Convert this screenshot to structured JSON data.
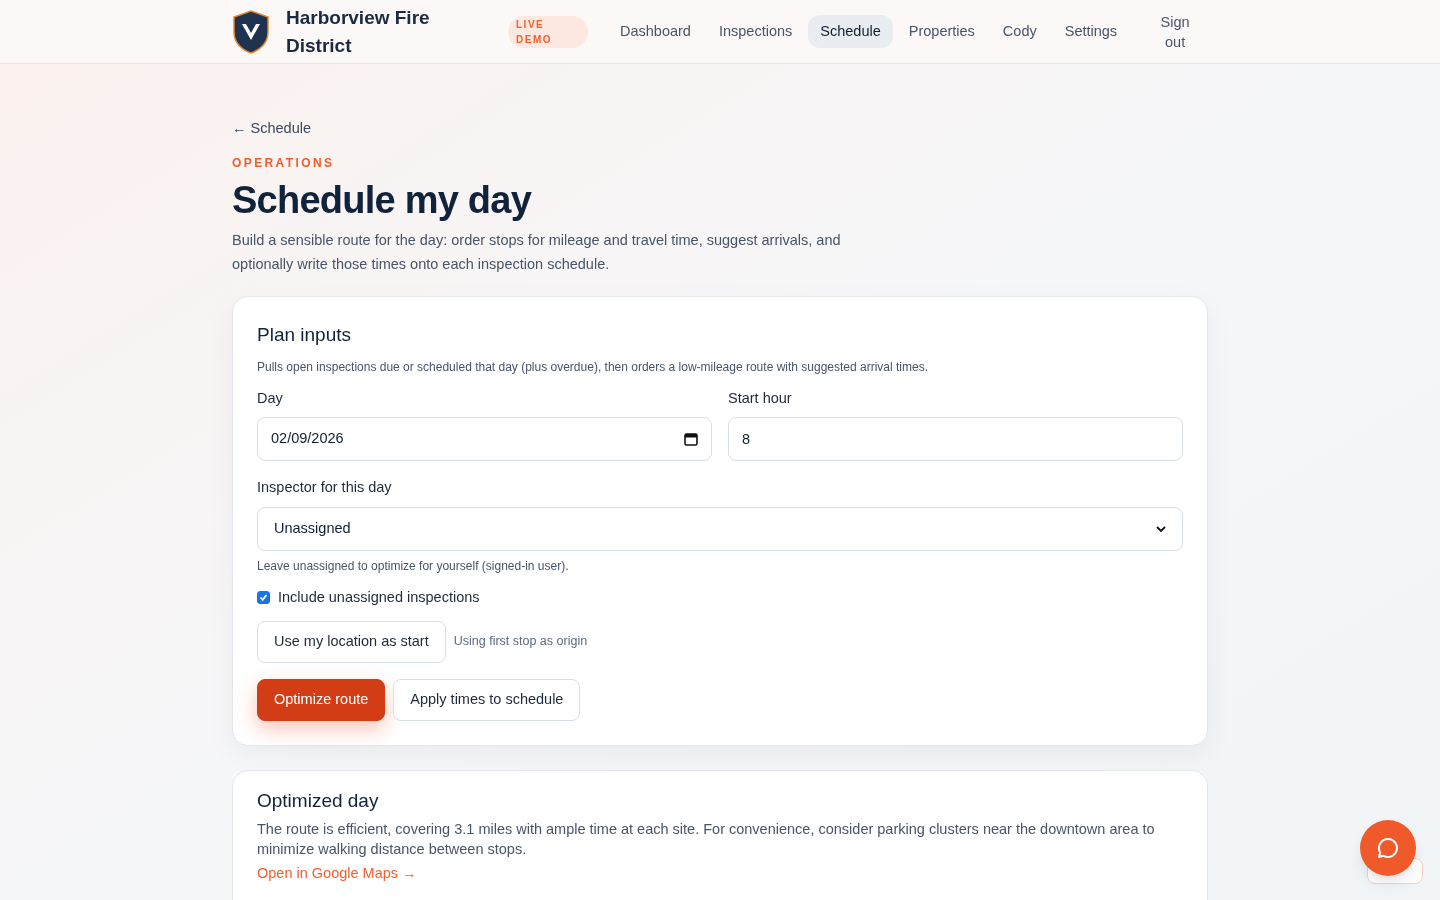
{
  "header": {
    "brand": "Harborview Fire District",
    "badge": "LIVE DEMO",
    "nav": [
      {
        "label": "Dashboard",
        "selected": false
      },
      {
        "label": "Inspections",
        "selected": false
      },
      {
        "label": "Schedule",
        "selected": true
      },
      {
        "label": "Properties",
        "selected": false
      },
      {
        "label": "Cody",
        "selected": false
      },
      {
        "label": "Settings",
        "selected": false
      },
      {
        "label": "Sign out",
        "selected": false
      }
    ]
  },
  "back_link": "← Schedule",
  "eyebrow": "OPERATIONS",
  "title": "Schedule my day",
  "intro": "Build a sensible route for the day: order stops for mileage and travel time, suggest arrivals, and optionally write those times onto each inspection schedule.",
  "plan": {
    "title": "Plan inputs",
    "description": "Pulls open inspections due or scheduled that day (plus overdue), then orders a low-mileage route with suggested arrival times.",
    "day": {
      "label": "Day",
      "value": "02/09/2026"
    },
    "start_hour": {
      "label": "Start hour",
      "value": "8"
    },
    "inspector": {
      "label": "Inspector for this day",
      "value": "Unassigned",
      "hint": "Leave unassigned to optimize for yourself (signed-in user)."
    },
    "include_unassigned": {
      "label": "Include unassigned inspections",
      "checked": true
    },
    "location_button": "Use my location as start",
    "origin_note": "Using first stop as origin",
    "buttons": [
      {
        "label": "Optimize route",
        "kind": "primary"
      },
      {
        "label": "Apply times to schedule",
        "kind": "secondary"
      }
    ]
  },
  "result": {
    "title": "Optimized day",
    "summary": "The route is efficient, covering 3.1 miles with ample time at each site. For convenience, consider parking clusters near the downtown area to minimize walking distance between stops.",
    "link": "Open in Google Maps →"
  }
}
